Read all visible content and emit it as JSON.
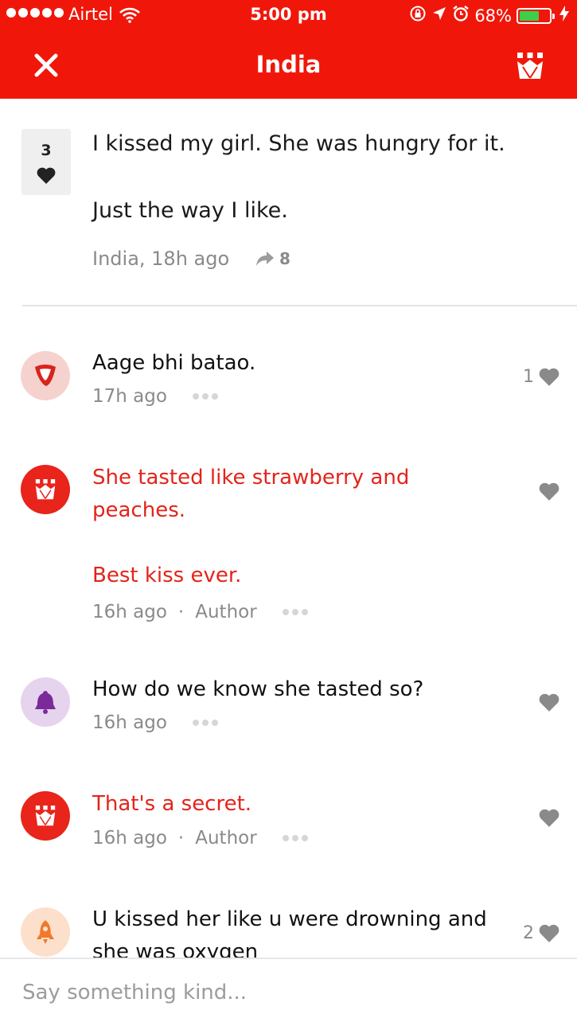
{
  "status_bar": {
    "carrier": "Airtel",
    "time": "5:00 pm",
    "battery": "68%",
    "battery_level": 0.68
  },
  "nav": {
    "title": "India",
    "close_icon": "close-icon",
    "crown_icon": "crown-icon"
  },
  "colors": {
    "brand": "#f0170a",
    "author": "#e3241b"
  },
  "post": {
    "votes": "3",
    "text_line1": "I kissed my girl.  She was hungry for it.",
    "text_line2": "Just the way I like.",
    "meta": "India, 18h ago",
    "shares": "8"
  },
  "comments": [
    {
      "lines": [
        "Aage bhi batao."
      ],
      "time": "17h ago",
      "author": "",
      "likes": "1",
      "avatar_icon": "steak-icon"
    },
    {
      "lines": [
        "She tasted like strawberry and",
        "peaches.",
        "",
        "Best kiss ever."
      ],
      "time": "16h ago",
      "author": "Author",
      "likes": "",
      "avatar_icon": "crown-icon"
    },
    {
      "lines": [
        "How do we know she tasted so?"
      ],
      "time": "16h ago",
      "author": "",
      "likes": "",
      "avatar_icon": "bell-icon"
    },
    {
      "lines": [
        "That's a secret."
      ],
      "time": "16h ago",
      "author": "Author",
      "likes": "",
      "avatar_icon": "crown-icon"
    },
    {
      "lines": [
        "U kissed her like u were drowning and",
        "she was oxygen"
      ],
      "time": "",
      "author": "",
      "likes": "2",
      "avatar_icon": "rocket-icon"
    }
  ],
  "composer": {
    "placeholder": "Say something kind..."
  }
}
